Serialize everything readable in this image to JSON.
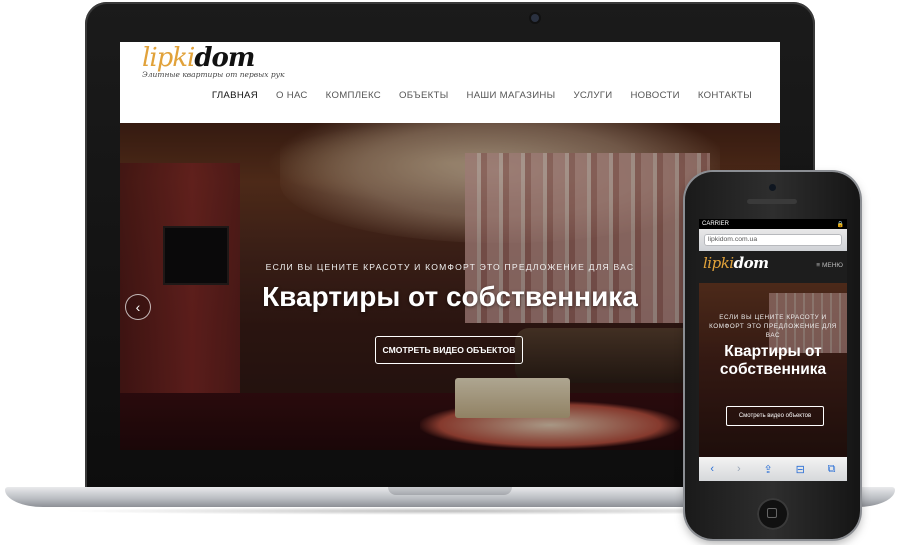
{
  "site": {
    "logo_main_a": "lipki",
    "logo_main_b": "dom",
    "logo_tagline": "Элитные квартиры от первых рук",
    "nav": [
      "ГЛАВНАЯ",
      "О НАС",
      "КОМПЛЕКС",
      "ОБЪЕКТЫ",
      "НАШИ МАГАЗИНЫ",
      "УСЛУГИ",
      "НОВОСТИ",
      "КОНТАКТЫ"
    ],
    "hero_subtitle": "ЕСЛИ ВЫ ЦЕНИТЕ КРАСОТУ И КОМФОРТ ЭТО ПРЕДЛОЖЕНИЕ ДЛЯ ВАС",
    "hero_title": "Квартиры от собственника",
    "hero_button": "СМОТРЕТЬ ВИДЕО ОБЪЕКТОВ",
    "prev_arrow": "‹"
  },
  "phone": {
    "carrier": "CARRIER",
    "lock": "🔒",
    "url": "lipkidom.com.ua",
    "menu_label": "МЕНЮ",
    "hero_subtitle": "ЕСЛИ ВЫ ЦЕНИТЕ КРАСОТУ И КОМФОРТ ЭТО ПРЕДЛОЖЕНИЕ ДЛЯ ВАС",
    "hero_title": "Квартиры от собственника",
    "hero_button": "Смотреть видео объектов",
    "toolbar": {
      "back": "‹",
      "forward": "›",
      "share": "⇪",
      "bookmarks": "⊟",
      "tabs": "⧉"
    }
  },
  "colors": {
    "accent": "#e1a23a",
    "nav_text": "#555555",
    "toolbar_blue": "#2a6fd6"
  }
}
